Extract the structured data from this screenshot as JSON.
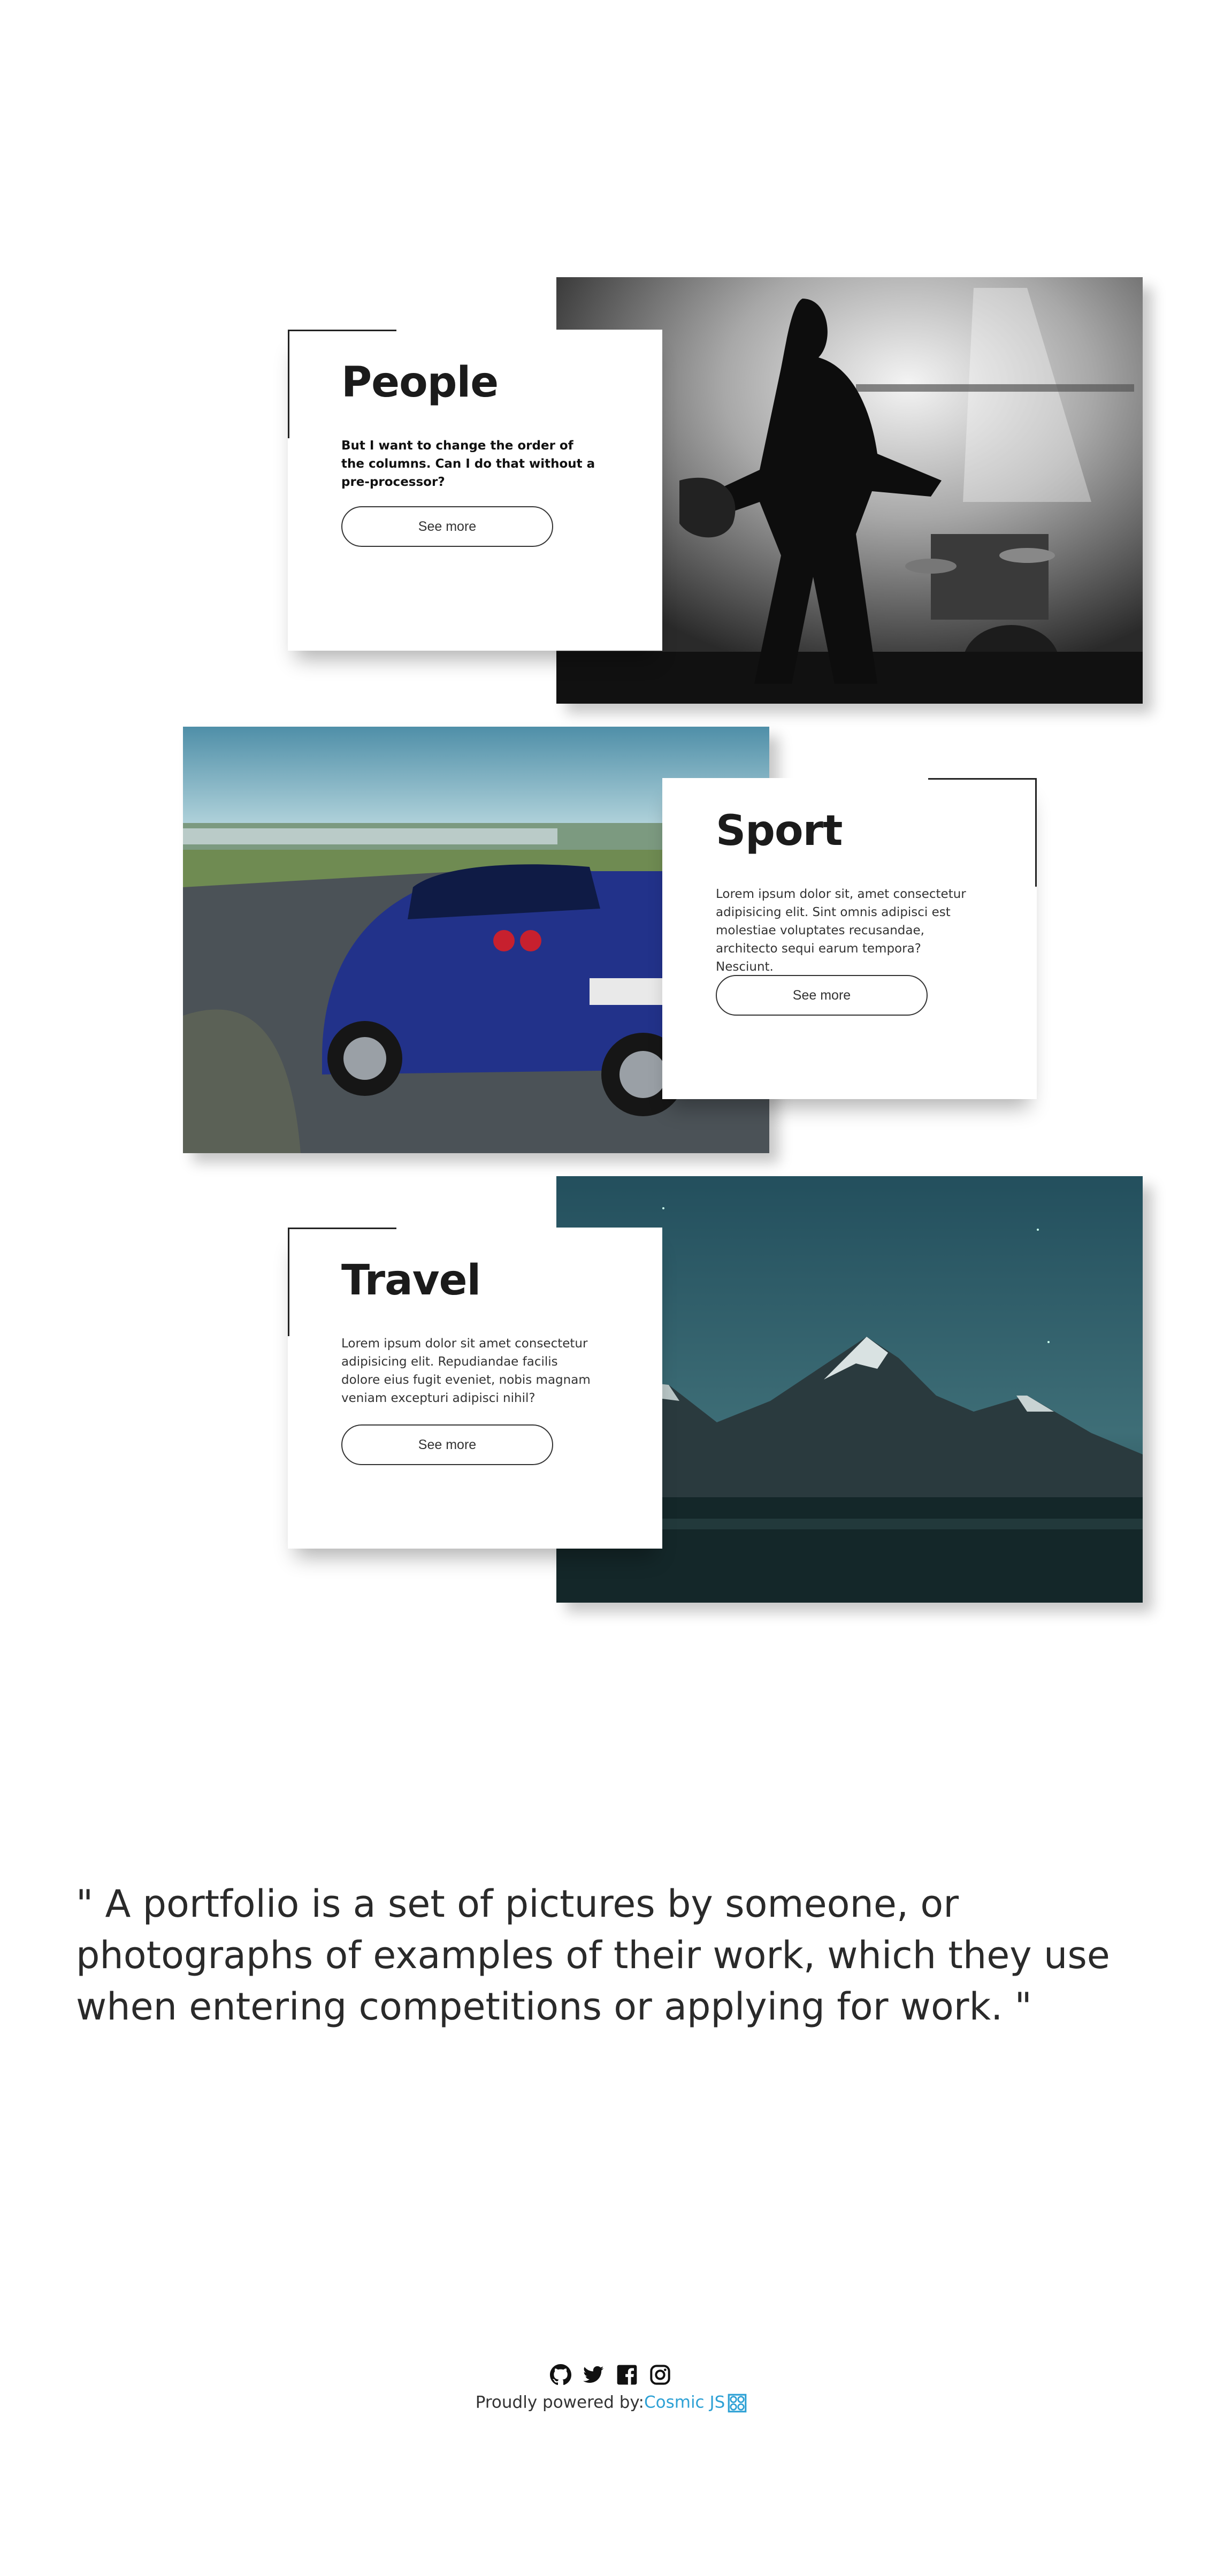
{
  "sections": [
    {
      "title": "People",
      "text": "But I want to change the order of the columns. Can I do that without a pre-processor?",
      "button_label": "See more",
      "image": "concert-guitarist-photo"
    },
    {
      "title": "Sport",
      "text": "Lorem ipsum dolor sit, amet consectetur adipisicing elit. Sint omnis adipisci est molestiae voluptates recusandae, architecto sequi earum tempora? Nesciunt.",
      "button_label": "See more",
      "image": "race-car-photo"
    },
    {
      "title": "Travel",
      "text": "Lorem ipsum dolor sit amet consectetur adipisicing elit. Repudiandae facilis dolore eius fugit eveniet, nobis magnam veniam excepturi adipisci nihil?",
      "button_label": "See more",
      "image": "mountain-night-photo"
    }
  ],
  "quote": "\" A portfolio is a set of pictures by someone, or photographs of examples of their work, which they use when entering competitions or applying for work. \"",
  "footer": {
    "powered_by": "Proudly powered by:",
    "brand": "Cosmic JS",
    "icons": [
      "github-icon",
      "twitter-icon",
      "facebook-icon",
      "instagram-icon"
    ],
    "brand_color": "#2ea1d5"
  }
}
